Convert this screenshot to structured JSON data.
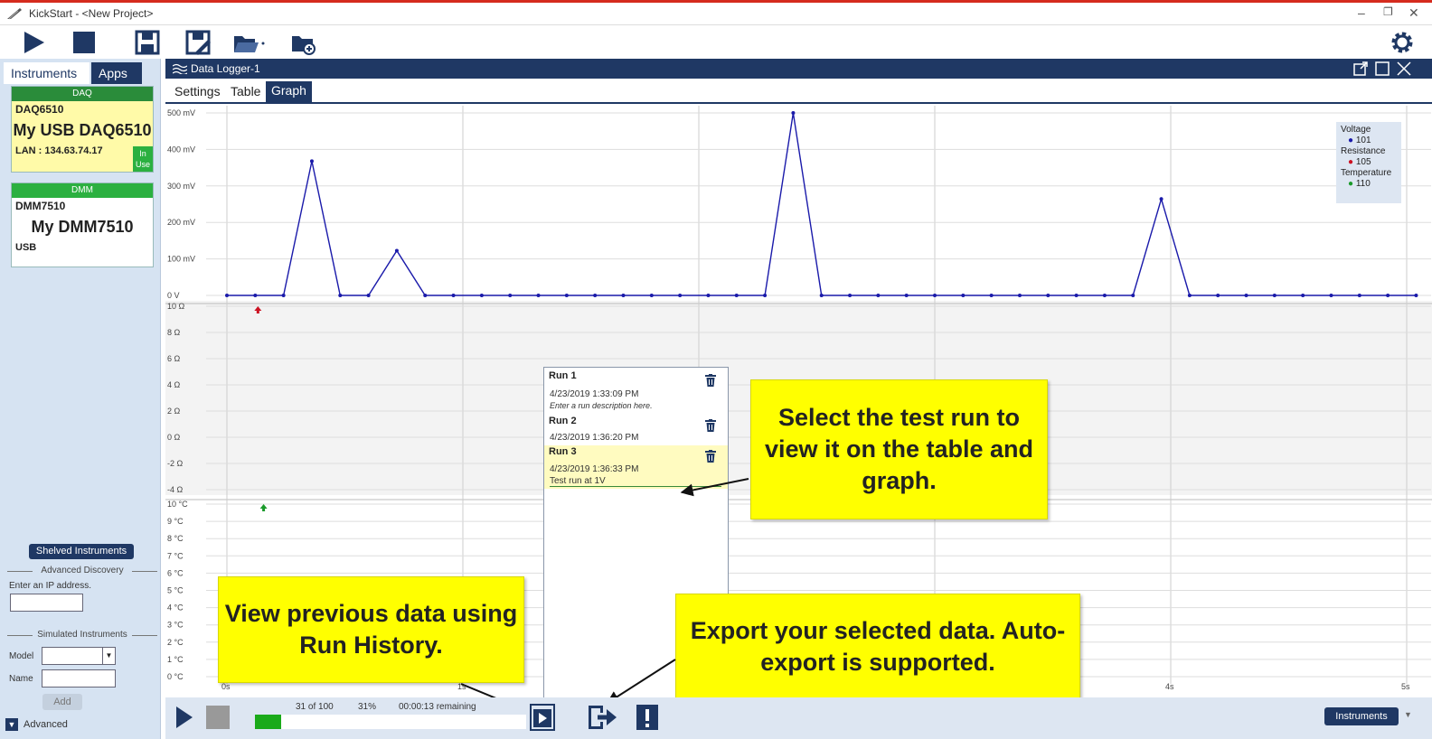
{
  "window": {
    "title": "KickStart - <New Project>"
  },
  "left_panel": {
    "tabs": [
      "Instruments",
      "Apps"
    ],
    "instruments": [
      {
        "category": "DAQ",
        "model": "DAQ6510",
        "name": "My USB DAQ6510",
        "connection": "LAN : 134.63.74.17",
        "status_line1": "In",
        "status_line2": "Use",
        "header_color": "#2a8c3a",
        "card_color": "#fffaa8"
      },
      {
        "category": "DMM",
        "model": "DMM7510",
        "name": "My DMM7510",
        "connection": "USB",
        "header_color": "#2bb040",
        "card_color": "#ffffff"
      }
    ],
    "shelved_button": "Shelved Instruments",
    "advanced_discovery_label": "Advanced Discovery",
    "ip_prompt": "Enter an IP address.",
    "simulated_label": "Simulated Instruments",
    "model_label": "Model",
    "name_label": "Name",
    "add_button": "Add",
    "advanced_label": "Advanced"
  },
  "main": {
    "window_title": "Data Logger-1",
    "tabs": [
      "Settings",
      "Table",
      "Graph"
    ],
    "active_tab": "Graph"
  },
  "chart_data": [
    {
      "type": "line",
      "series": [
        {
          "name": "Voltage",
          "color": "#1a1aaa",
          "x": [
            0,
            0.1,
            0.2,
            0.3,
            0.4,
            0.5,
            0.6,
            0.7,
            0.8,
            0.9,
            1.0,
            1.1,
            1.2,
            1.3,
            1.4,
            1.5,
            1.6,
            1.7,
            1.8,
            1.9,
            2.0,
            2.1,
            2.2,
            2.3,
            2.4,
            2.5,
            2.6,
            2.7,
            2.8,
            2.9,
            3.0,
            3.1,
            3.2,
            3.3,
            3.4,
            3.5,
            3.6,
            3.7,
            3.8,
            3.9,
            4.0,
            4.1,
            4.2
          ],
          "values": [
            0,
            0,
            0,
            390,
            0,
            0,
            130,
            0,
            0,
            0,
            0,
            0,
            0,
            0,
            0,
            0,
            0,
            0,
            0,
            0,
            530,
            0,
            0,
            0,
            0,
            0,
            0,
            0,
            0,
            0,
            0,
            0,
            0,
            280,
            0,
            0,
            0,
            0,
            0,
            0,
            0,
            0,
            0
          ]
        }
      ],
      "ylabel_ticks": [
        "0 V",
        "100 mV",
        "200 mV",
        "300 mV",
        "400 mV",
        "500 mV"
      ],
      "ylim": [
        0,
        530
      ]
    },
    {
      "type": "line",
      "series": [
        {
          "name": "Resistance",
          "color": "#cc1122",
          "x": [
            0.1
          ],
          "values": [
            10
          ]
        }
      ],
      "ylabel_ticks": [
        "-4 Ω",
        "-2 Ω",
        "0 Ω",
        "2 Ω",
        "4 Ω",
        "6 Ω",
        "8 Ω",
        "10 Ω"
      ],
      "ylim": [
        -4,
        10
      ]
    },
    {
      "type": "line",
      "series": [
        {
          "name": "Temperature",
          "color": "#1a9a2a",
          "x": [
            0.12
          ],
          "values": [
            10
          ]
        }
      ],
      "ylabel_ticks": [
        "0 °C",
        "1 °C",
        "2 °C",
        "3 °C",
        "4 °C",
        "5 °C",
        "6 °C",
        "7 °C",
        "8 °C",
        "9 °C",
        "10 °C"
      ],
      "ylim": [
        0,
        10
      ]
    }
  ],
  "x_ticks": [
    "0s",
    "1s",
    "4s",
    "5s"
  ],
  "legend": [
    {
      "name": "Voltage",
      "channel": "101",
      "color": "#1a1aaa"
    },
    {
      "name": "Resistance",
      "channel": "105",
      "color": "#cc1122"
    },
    {
      "name": "Temperature",
      "channel": "110",
      "color": "#1a9a2a"
    }
  ],
  "run_history": [
    {
      "name": "Run  1",
      "date": "4/23/2019 1:33:09 PM",
      "description": "Enter a run description here.",
      "selected": false
    },
    {
      "name": "Run  2",
      "date": "4/23/2019 1:36:20 PM",
      "description": "",
      "selected": false
    },
    {
      "name": "Run  3",
      "date": "4/23/2019 1:36:33 PM",
      "description": "Test run at 1V",
      "selected": true
    }
  ],
  "callouts": {
    "select": "Select the test run to view it on the table and graph.",
    "previous": "View previous data using Run History.",
    "export": "Export your selected data. Auto-export is supported."
  },
  "progress": {
    "count_text": "31 of 100",
    "percent_text": "31%",
    "fraction": 0.31,
    "remaining": "00:00:13 remaining"
  },
  "bottom": {
    "instruments_button": "Instruments"
  }
}
